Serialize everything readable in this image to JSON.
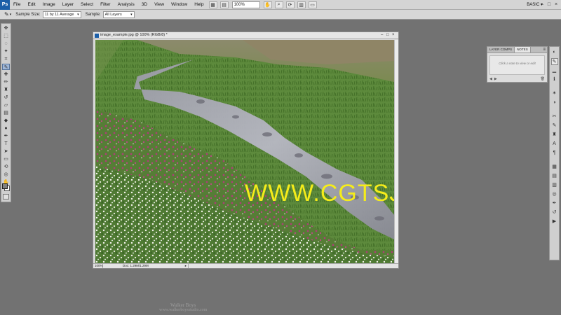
{
  "app": {
    "logo": "Ps",
    "menu": [
      "File",
      "Edit",
      "Image",
      "Layer",
      "Select",
      "Filter",
      "Analysis",
      "3D",
      "View",
      "Window",
      "Help"
    ],
    "zoom": "100%",
    "workspace": "BASIC",
    "workspace_arrow": "▾",
    "window_controls": [
      "–",
      "□",
      "×"
    ],
    "toolbar_icons": [
      "bridge-icon",
      "minibridge-icon",
      "zoom-level-box",
      "hand-icon",
      "zoom-icon",
      "rotate-icon",
      "arrange-icon",
      "screen-mode-icon"
    ]
  },
  "options": {
    "tool_icon": "eyedropper-icon",
    "sample_size_label": "Sample Size:",
    "sample_size_value": "11 by 11 Average",
    "sample_label": "Sample:",
    "sample_value": "All Layers"
  },
  "document": {
    "title": "image_example.jpg @ 100% (RGB/8) *",
    "zoom": "100%",
    "doc_info": "Doc: 1.29M/1.29M",
    "controls": [
      "–",
      "□",
      "×"
    ]
  },
  "watermark": "WWW.CGTSJ.COM",
  "panels": {
    "tabs": [
      "LAYER COMPS",
      "NOTES"
    ],
    "active_tab": "NOTES",
    "menu_glyph": "≡",
    "notes_hint": "Click a note to view or edit"
  },
  "credits": {
    "name": "Walker Boys",
    "url": "www.walkerboysstudio.com"
  },
  "colors": {
    "foreground": "#808080",
    "background": "#ffffff",
    "watermark": "#f5ec1a",
    "accent": "#1b5ea8"
  }
}
